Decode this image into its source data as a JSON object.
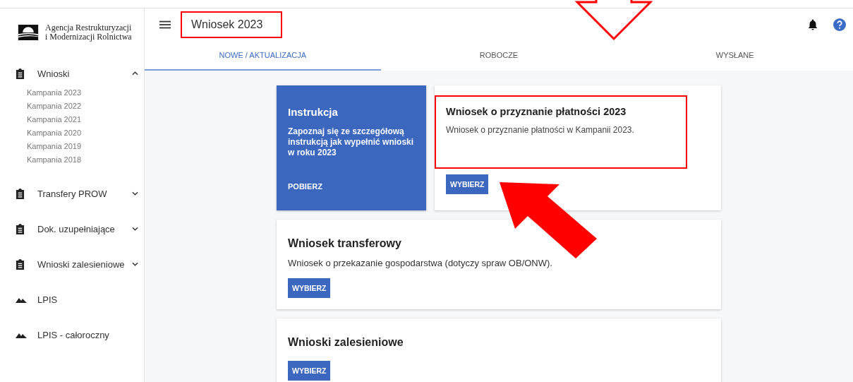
{
  "logo": {
    "line1": "Agencja Restrukturyzacji",
    "line2": "i Modernizacji Rolnictwa"
  },
  "header": {
    "title": "Wniosek 2023",
    "title_highlighted": true
  },
  "tabs": [
    {
      "label": "NOWE / AKTUALIZACJA",
      "selected": true
    },
    {
      "label": "ROBOCZE",
      "selected": false
    },
    {
      "label": "WYSŁANE",
      "selected": false
    }
  ],
  "sidebar": {
    "items": [
      {
        "label": "Wnioski",
        "kind": "clipboard",
        "expanded": true,
        "children": [
          {
            "label": "Kampania 2023"
          },
          {
            "label": "Kampania 2022"
          },
          {
            "label": "Kampania 2021"
          },
          {
            "label": "Kampania 2020"
          },
          {
            "label": "Kampania 2019"
          },
          {
            "label": "Kampania 2018"
          }
        ]
      },
      {
        "label": "Transfery PROW",
        "kind": "clipboard",
        "expanded": false
      },
      {
        "label": "Dok. uzupełniające",
        "kind": "clipboard",
        "expanded": false
      },
      {
        "label": "Wnioski zalesieniowe",
        "kind": "clipboard",
        "expanded": false
      },
      {
        "label": "LPIS",
        "kind": "terrain"
      },
      {
        "label": "LPIS - całoroczny",
        "kind": "terrain"
      }
    ]
  },
  "instruction_card": {
    "title": "Instrukcja",
    "text": "Zapoznaj się ze szczegółową instrukcją jak wypełnić wnioski w roku 2023",
    "action": "POBIERZ"
  },
  "cards": [
    {
      "title": "Wniosek o przyznanie płatności 2023",
      "description": "Wniosek o przyznanie płatności w Kampanii 2023.",
      "button": "WYBIERZ",
      "highlighted": true
    },
    {
      "title": "Wniosek transferowy",
      "description": "Wniosek o przekazanie gospodarstwa (dotyczy spraw OB/ONW).",
      "button": "WYBIERZ",
      "highlighted": false
    },
    {
      "title": "Wnioski zalesieniowe",
      "button": "WYBIERZ",
      "highlighted": false
    }
  ],
  "annotation_arrows": [
    {
      "kind": "outline"
    },
    {
      "kind": "filled"
    }
  ]
}
